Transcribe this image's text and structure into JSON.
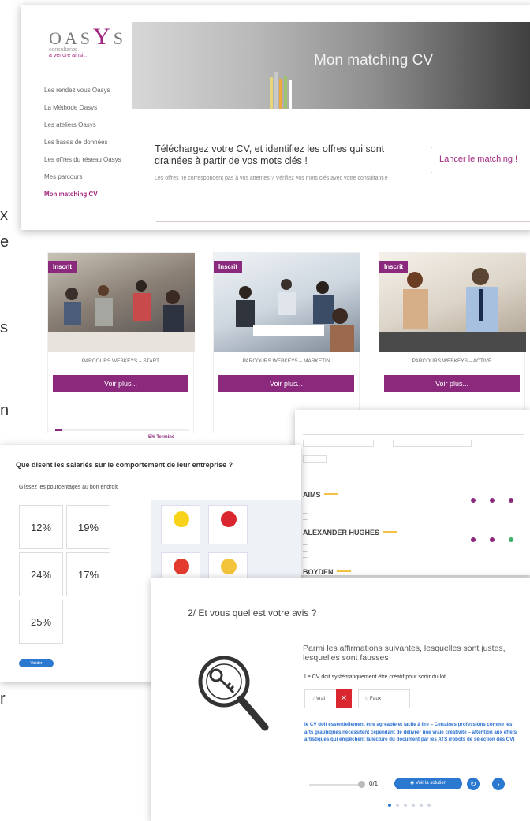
{
  "brand": {
    "logo_text": "OASYS",
    "logo_tagline": "consultants",
    "logo_tagline2": "à vendre ainsi…",
    "accent_color": "#8b2a7c"
  },
  "matching": {
    "hero_title": "Mon matching CV",
    "nav": [
      "Les rendez vous Oasys",
      "La Méthode Oasys",
      "Les ateliers Oasys",
      "Les bases de données",
      "Les offres du réseau Oasys",
      "Mes parcours",
      "Mon matching CV"
    ],
    "heading": "Téléchargez votre CV, et identifiez les offres qui sont drainées à partir de vos mots clés !",
    "description": "Les offres ne correspondent pas à vos attentes ? Vérifiez vos mots clés avec votre consultant·e",
    "launch_button": "Lancer le matching !"
  },
  "left_edge_chars": [
    "x",
    "e",
    "s",
    "n",
    "r"
  ],
  "cards": [
    {
      "badge": "Inscrit",
      "caption": "PARCOURS WEBKEYS – START",
      "button": "Voir plus..."
    },
    {
      "badge": "Inscrit",
      "caption": "PARCOURS WEBKEYS – MARKETIN",
      "button": "Voir plus..."
    },
    {
      "badge": "Inscrit",
      "caption": "PARCOURS WEBKEYS – ACTIVE",
      "button": "Voir plus..."
    }
  ],
  "progress": {
    "label": "5% Terminé",
    "fraction": 0.05
  },
  "company_search": {
    "companies": [
      {
        "name": "AIMS"
      },
      {
        "name": "ALEXANDER HUGHES"
      },
      {
        "name": "BOYDEN"
      }
    ]
  },
  "survey": {
    "title": "Que disent les salariés sur le comportement de leur entreprise ?",
    "instruction": "Glissez les pourcentages au bon endroit.",
    "percentages": [
      "12%",
      "19%",
      "24%",
      "17%",
      "25%"
    ],
    "validate": "Valider"
  },
  "quiz": {
    "title": "2/ Et vous quel est votre avis ?",
    "question": "Parmi les affirmations suivantes, lesquelles sont justes, lesquelles sont fausses",
    "statement": "Le CV doit systématiquement être créatif pour sortir du lot",
    "option_true": "Vrai",
    "option_false": "Faux",
    "answer": "le CV doit essentiellement être agréable et facile à lire – Certaines professions comme les arts graphiques nécessitent cependant de délivrer une vraie créativité – attention aux effets artistiques qui empêchent la lecture du document par les ATS (robots de sélection des CV)",
    "score": "0/1",
    "solution_button": "Voir la solution"
  }
}
